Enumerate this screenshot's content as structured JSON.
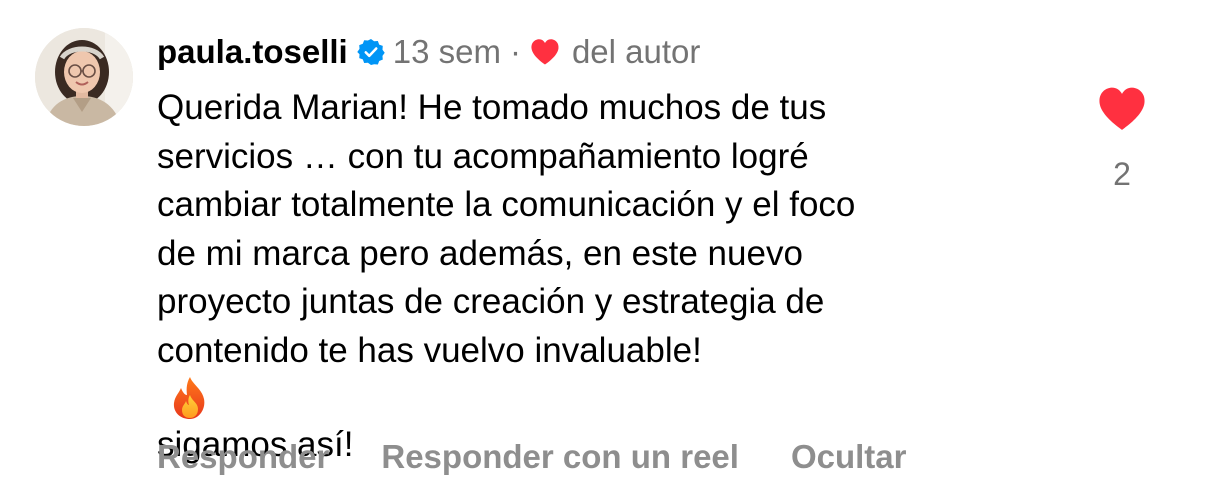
{
  "comment": {
    "username": "paula.toselli",
    "verified": true,
    "time": "13 sem",
    "separator": "·",
    "author_like_label": "del autor",
    "body_lines": [
      "Querida Marian! He tomado muchos de tus",
      "servicios … con tu acompañamiento logré",
      "cambiar totalmente la comunicación y el foco",
      "de mi marca pero además, en este nuevo",
      "proyecto juntas de creación y estrategia de",
      "contenido te has vuelvo invaluable!",
      "sigamos así!"
    ],
    "emoji": "fire-emoji",
    "like_icon": "heart-icon",
    "like_count": "2",
    "like_color": "#ff3040",
    "verified_color": "#0095f6"
  },
  "actions": {
    "reply": "Responder",
    "reply_reel": "Responder con un reel",
    "hide": "Ocultar"
  }
}
